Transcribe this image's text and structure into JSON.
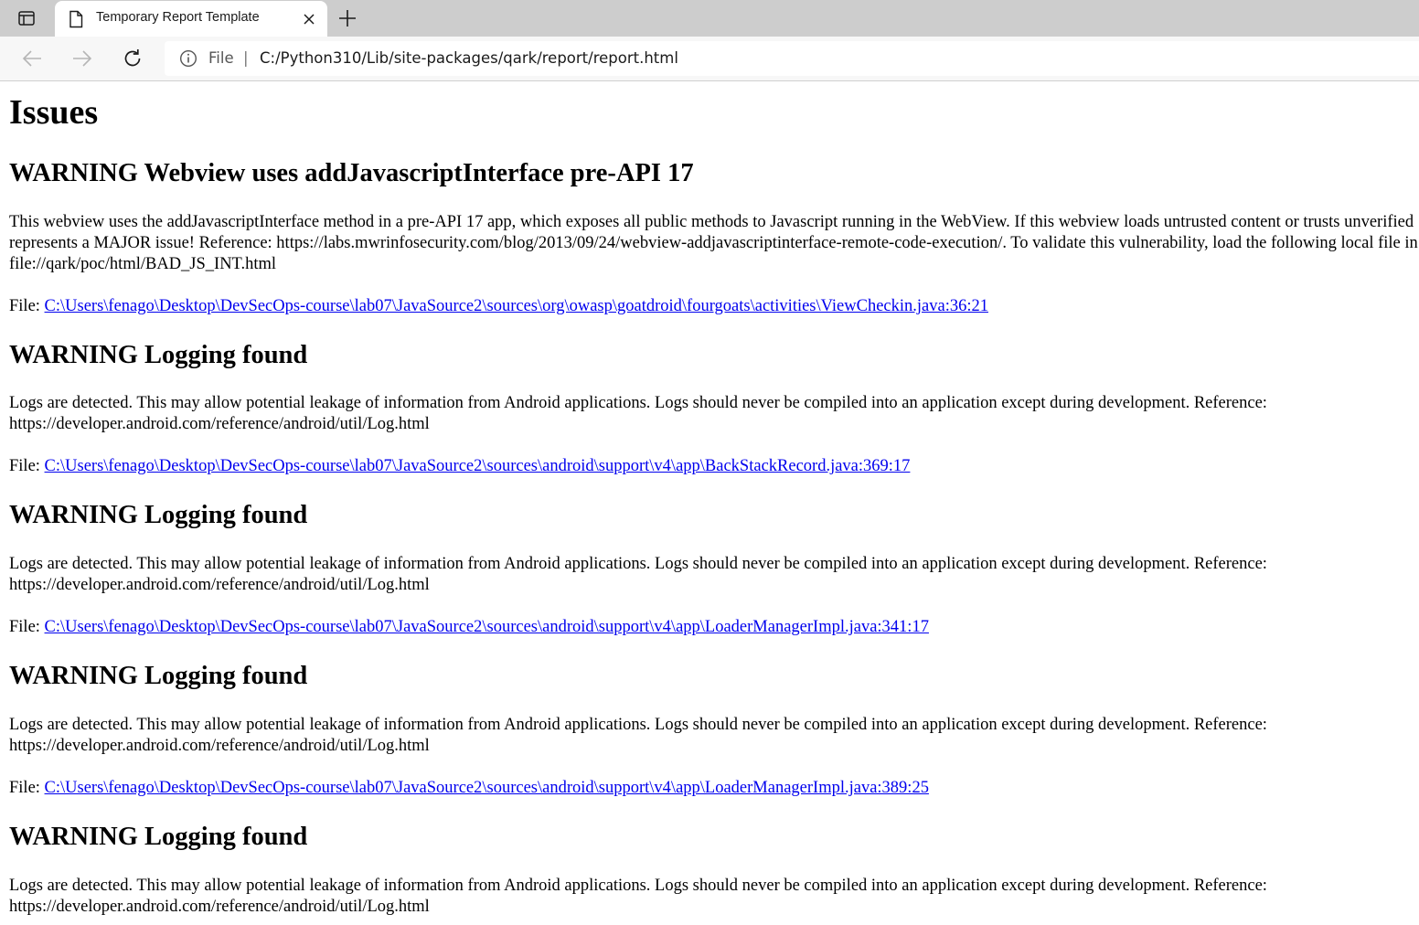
{
  "browser": {
    "tab_title": "Temporary Report Template",
    "address": {
      "scheme_label": "File",
      "separator": "|",
      "url": "C:/Python310/Lib/site-packages/qark/report/report.html"
    },
    "icons": {
      "tab_actions": "tab-actions-icon",
      "tab_page": "page-icon",
      "close": "close-icon",
      "new_tab": "plus-icon",
      "back": "arrow-left-icon",
      "forward": "arrow-right-icon",
      "refresh": "refresh-icon",
      "info": "info-icon"
    }
  },
  "report": {
    "title": "Issues",
    "file_prefix": "File: ",
    "issues": [
      {
        "heading": "WARNING Webview uses addJavascriptInterface pre-API 17",
        "description_lines": [
          "This webview uses the addJavascriptInterface method in a pre-API 17 app, which exposes all public methods to Javascript running in the WebView. If this webview loads untrusted content or trusts unverified SSL certificates, this",
          "represents a MAJOR issue! Reference: https://labs.mwrinfosecurity.com/blog/2013/09/24/webview-addjavascriptinterface-remote-code-execution/. To validate this vulnerability, load the following local file in this WebView:",
          "file://qark/poc/html/BAD_JS_INT.html"
        ],
        "file": "C:\\Users\\fenago\\Desktop\\DevSecOps-course\\lab07\\JavaSource2\\sources\\org\\owasp\\goatdroid\\fourgoats\\activities\\ViewCheckin.java:36:21"
      },
      {
        "heading": "WARNING Logging found",
        "description_lines": [
          "Logs are detected. This may allow potential leakage of information from Android applications. Logs should never be compiled into an application except during development. Reference:",
          "https://developer.android.com/reference/android/util/Log.html"
        ],
        "file": "C:\\Users\\fenago\\Desktop\\DevSecOps-course\\lab07\\JavaSource2\\sources\\android\\support\\v4\\app\\BackStackRecord.java:369:17"
      },
      {
        "heading": "WARNING Logging found",
        "description_lines": [
          "Logs are detected. This may allow potential leakage of information from Android applications. Logs should never be compiled into an application except during development. Reference:",
          "https://developer.android.com/reference/android/util/Log.html"
        ],
        "file": "C:\\Users\\fenago\\Desktop\\DevSecOps-course\\lab07\\JavaSource2\\sources\\android\\support\\v4\\app\\LoaderManagerImpl.java:341:17"
      },
      {
        "heading": "WARNING Logging found",
        "description_lines": [
          "Logs are detected. This may allow potential leakage of information from Android applications. Logs should never be compiled into an application except during development. Reference:",
          "https://developer.android.com/reference/android/util/Log.html"
        ],
        "file": "C:\\Users\\fenago\\Desktop\\DevSecOps-course\\lab07\\JavaSource2\\sources\\android\\support\\v4\\app\\LoaderManagerImpl.java:389:25"
      },
      {
        "heading": "WARNING Logging found",
        "description_lines": [
          "Logs are detected. This may allow potential leakage of information from Android applications. Logs should never be compiled into an application except during development. Reference:",
          "https://developer.android.com/reference/android/util/Log.html"
        ]
      }
    ]
  }
}
